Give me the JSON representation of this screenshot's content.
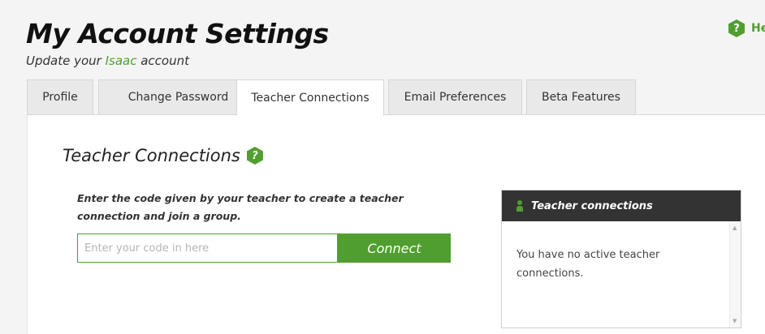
{
  "header": {
    "title": "My Account Settings",
    "subtitle_prefix": "Update your ",
    "subtitle_brand": "Isaac",
    "subtitle_suffix": " account",
    "help_icon": "?",
    "help_label": "He"
  },
  "tabs": [
    {
      "label": "Profile",
      "active": false
    },
    {
      "label": "Change Password",
      "active": false
    },
    {
      "label": "Teacher Connections",
      "active": true
    },
    {
      "label": "Email Preferences",
      "active": false
    },
    {
      "label": "Beta Features",
      "active": false
    }
  ],
  "teacher_connections": {
    "title": "Teacher Connections",
    "help_icon": "?",
    "instructions": "Enter the code given by your teacher to create a teacher connection and join a group.",
    "code_input": {
      "placeholder": "Enter your code in here",
      "value": ""
    },
    "connect_label": "Connect",
    "panel": {
      "header": "Teacher connections",
      "empty_message": "You have no active teacher connections."
    }
  },
  "icons": {
    "help": "question-hexagon-icon",
    "person": "person-icon",
    "scroll_up": "▲",
    "scroll_down": "▼"
  },
  "colors": {
    "accent": "#509e2f",
    "panel_header": "#333333",
    "tab_inactive": "#e9e9e9"
  }
}
